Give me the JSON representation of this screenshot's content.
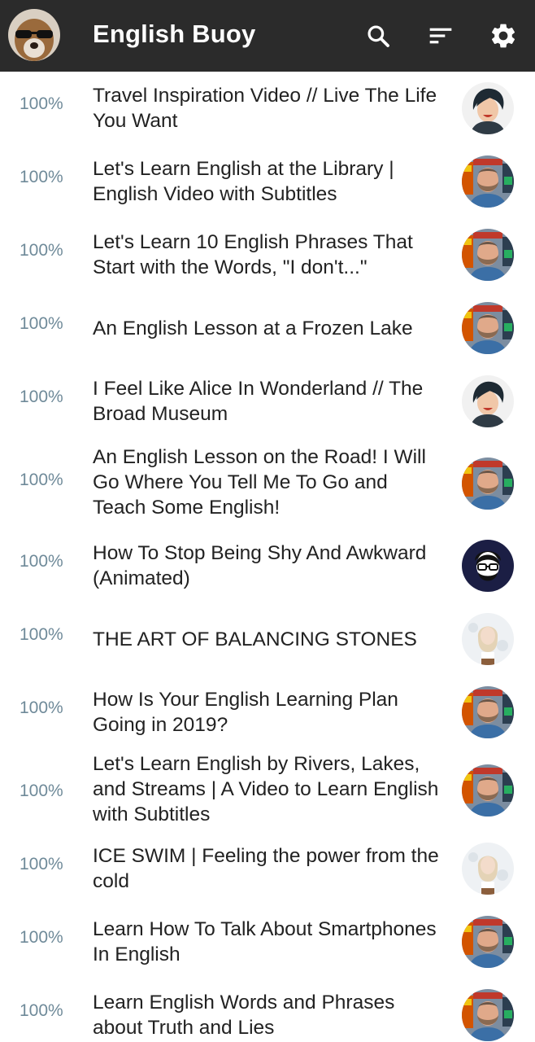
{
  "app": {
    "title": "English Buoy"
  },
  "toolbar": {
    "search_icon": "search-icon",
    "sort_icon": "sort-icon",
    "settings_icon": "gear-icon"
  },
  "colors": {
    "toolbar_bg": "#2b2b2b",
    "percent_text": "#6f8a99",
    "title_text": "#222222"
  },
  "videos": [
    {
      "progress": "100%",
      "title": "Travel Inspiration Video // Live The Life You Want",
      "channel_avatar": "woman-dark-hair"
    },
    {
      "progress": "100%",
      "title": "Let's Learn English at the Library | English Video with Subtitles",
      "channel_avatar": "bearded-man"
    },
    {
      "progress": "100%",
      "title": "Let's Learn 10 English Phrases That Start with the Words, \"I don't...\"",
      "channel_avatar": "bearded-man"
    },
    {
      "progress": "100%",
      "title": "An English Lesson at a Frozen Lake",
      "channel_avatar": "bearded-man"
    },
    {
      "progress": "100%",
      "title": "I Feel Like Alice In Wonderland // The Broad Museum",
      "channel_avatar": "woman-dark-hair"
    },
    {
      "progress": "100%",
      "title": "An English Lesson on the Road! I Will Go Where You Tell Me To Go and Teach Some English!",
      "channel_avatar": "bearded-man"
    },
    {
      "progress": "100%",
      "title": "How To Stop Being Shy And Awkward (Animated)",
      "channel_avatar": "cartoon-man"
    },
    {
      "progress": "100%",
      "title": "THE ART OF BALANCING STONES",
      "channel_avatar": "woman-blonde"
    },
    {
      "progress": "100%",
      "title": "How Is Your English Learning Plan Going in 2019?",
      "channel_avatar": "bearded-man"
    },
    {
      "progress": "100%",
      "title": "Let's Learn English by Rivers, Lakes, and Streams | A Video to Learn English with Subtitles",
      "channel_avatar": "bearded-man"
    },
    {
      "progress": "100%",
      "title": "ICE SWIM | Feeling the power from the cold",
      "channel_avatar": "woman-blonde"
    },
    {
      "progress": "100%",
      "title": "Learn How To Talk About Smartphones In English",
      "channel_avatar": "bearded-man"
    },
    {
      "progress": "100%",
      "title": "Learn English Words and Phrases about Truth and Lies",
      "channel_avatar": "bearded-man"
    }
  ]
}
